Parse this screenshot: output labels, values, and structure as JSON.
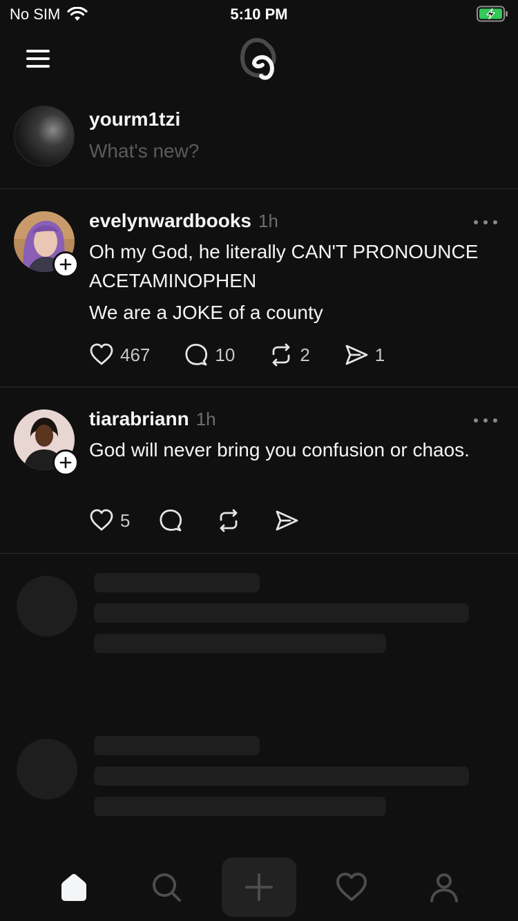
{
  "status_bar": {
    "carrier": "No SIM",
    "time": "5:10 PM",
    "battery_color": "#34c759"
  },
  "header": {
    "menu_icon": "hamburger-icon",
    "logo_icon": "threads-logo"
  },
  "composer": {
    "username": "yourm1tzi",
    "placeholder": "What's new?"
  },
  "posts": [
    {
      "username": "evelynwardbooks",
      "time": "1h",
      "lines": [
        "Oh my God, he literally CAN'T PRONOUNCE ACETAMINOPHEN",
        "We are a JOKE of a county"
      ],
      "likes": "467",
      "replies": "10",
      "reposts": "2",
      "shares": "1"
    },
    {
      "username": "tiarabriann",
      "time": "1h",
      "lines": [
        "God will never bring you confusion or chaos."
      ],
      "likes": "5",
      "replies": "",
      "reposts": "",
      "shares": ""
    }
  ],
  "tabbar": {
    "items": [
      "home-icon",
      "search-icon",
      "create-icon",
      "activity-icon",
      "profile-icon"
    ],
    "active": "home-icon"
  }
}
